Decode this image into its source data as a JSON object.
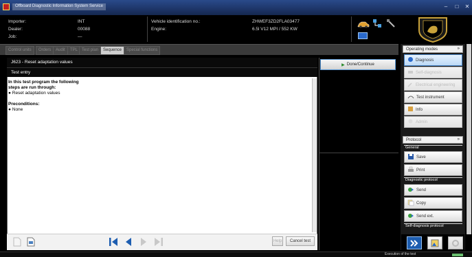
{
  "window": {
    "title": "Offboard Diagnostic Information System Service",
    "controls": [
      "–",
      "□",
      "✕"
    ]
  },
  "header": {
    "importer_label": "Importer:",
    "importer_value": "INT",
    "dealer_label": "Dealer:",
    "dealer_value": "00088",
    "job_label": "Job:",
    "job_value": "—",
    "vin_label": "Vehicle identification no.:",
    "vin_value": "ZHWEF3ZD2FLA03477",
    "engine_label": "Engine:",
    "engine_value": "6.5l V12 MPI / 552 KW"
  },
  "tabs": [
    {
      "label": "Control units",
      "active": false
    },
    {
      "label": "Orders",
      "active": false
    },
    {
      "label": "Audit",
      "active": false
    },
    {
      "label": "TPL",
      "active": false
    },
    {
      "label": "Test plan",
      "active": false
    },
    {
      "label": "Sequence",
      "active": true
    },
    {
      "label": "Special functions",
      "active": false
    }
  ],
  "main": {
    "title": "J623 - Reset adaptation values",
    "subtitle": "Test entry",
    "intro_line1": "In this test program the following",
    "intro_line2": "steps are run through:",
    "step1": "Reset adaptation values",
    "preconditions_label": "Preconditions:",
    "precondition1": "None",
    "bullet": "●"
  },
  "bottom": {
    "help_label": "Help",
    "cancel_label": "Cancel test"
  },
  "middle": {
    "done_label": "Done/Continue"
  },
  "operating_modes": {
    "header": "Operating modes",
    "items": [
      {
        "label": "Diagnosis",
        "icon": "stethoscope-icon",
        "state": "active"
      },
      {
        "label": "Self-diagnosis",
        "icon": "car-icon",
        "state": "disabled"
      },
      {
        "label": "Electrical engineering",
        "icon": "wrench-icon",
        "state": "disabled"
      },
      {
        "label": "Test instrument",
        "icon": "multimeter-icon",
        "state": "normal"
      },
      {
        "label": "Info",
        "icon": "info-icon",
        "state": "normal"
      },
      {
        "label": "Admin",
        "icon": "admin-icon",
        "state": "disabled"
      }
    ]
  },
  "protocol": {
    "header": "Protocol",
    "general_label": "General",
    "save_label": "Save",
    "print_label": "Print",
    "diag_label": "Diagnostic protocol",
    "send_label": "Send",
    "copy_label": "Copy",
    "sendext_label": "Send ext.",
    "selfdiag_label": "Self-diagnosis protocol"
  },
  "status": {
    "text": "Execution of the test"
  },
  "colors": {
    "active_tab": "#cfcfcf",
    "panel_bg": "#000000",
    "button_border": "#5a9ad8"
  }
}
